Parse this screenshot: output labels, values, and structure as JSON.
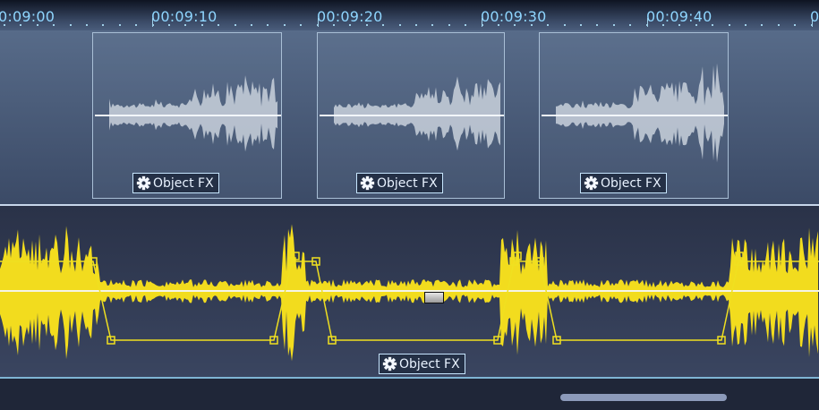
{
  "timeline": {
    "ticks": [
      {
        "label": "0:09:00"
      },
      {
        "label": "00:09:10"
      },
      {
        "label": "00:09:20"
      },
      {
        "label": "00:09:30"
      },
      {
        "label": "00:09:40"
      },
      {
        "label": "0"
      }
    ]
  },
  "clips": [
    {
      "fx_label": "Object FX"
    },
    {
      "fx_label": "Object FX"
    },
    {
      "fx_label": "Object FX"
    }
  ],
  "lower_track": {
    "fx_label": "Object FX"
  },
  "icons": {
    "fx": "gear-icon",
    "handle": "volume-handle-icon"
  },
  "colors": {
    "waveform_upper": "#c9d1dc",
    "waveform_lower": "#f2dc1e",
    "envelope": "#f0e020",
    "timeline_text": "#8fd6ff"
  }
}
